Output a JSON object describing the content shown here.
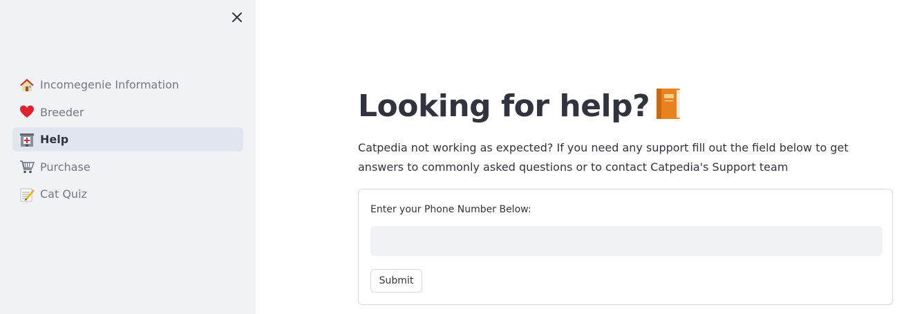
{
  "sidebar": {
    "close_icon": "close-icon",
    "items": [
      {
        "label": "Incomegenie Information",
        "icon": "house-icon",
        "active": false
      },
      {
        "label": "Breeder",
        "icon": "heart-icon",
        "active": false
      },
      {
        "label": "Help",
        "icon": "hospital-icon",
        "active": true
      },
      {
        "label": "Purchase",
        "icon": "shopping-cart-icon",
        "active": false
      },
      {
        "label": "Cat Quiz",
        "icon": "memo-icon",
        "active": false
      }
    ]
  },
  "main": {
    "title": "Looking for help?",
    "title_icon": "orange-book-icon",
    "description": "Catpedia not working as expected? If you need any support fill out the field below to get answers to commonly asked questions or to contact Catpedia's Support team",
    "form": {
      "label": "Enter your Phone Number Below:",
      "input_value": "",
      "submit_label": "Submit"
    }
  },
  "colors": {
    "sidebar_bg": "#f0f2f6",
    "active_item_bg": "#e1e5ee",
    "text_primary": "#31333f",
    "text_muted": "#757682",
    "input_bg": "#f0f2f6",
    "border": "#d6d6dc"
  }
}
